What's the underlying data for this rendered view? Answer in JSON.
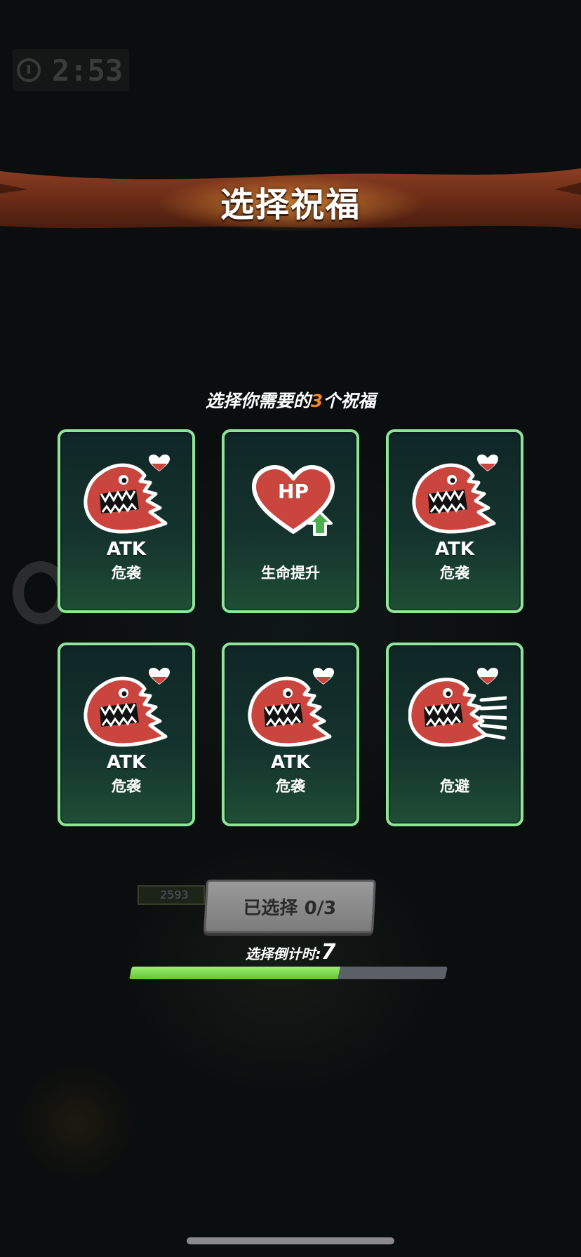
{
  "hud": {
    "time": "2:53",
    "icon": "clock-icon"
  },
  "header": {
    "title": "选择祝福"
  },
  "prompt": {
    "prefix": "选择你需要的",
    "count": "3",
    "suffix": "个祝福"
  },
  "cards": [
    {
      "icon": "dino-atk-icon",
      "badge": "heart-badge-icon",
      "atk_label": "ATK",
      "name": "危袭"
    },
    {
      "icon": "hp-heart-up-icon",
      "badge": "",
      "atk_label": "",
      "name": "生命提升"
    },
    {
      "icon": "dino-atk-icon",
      "badge": "heart-badge-icon",
      "atk_label": "ATK",
      "name": "危袭"
    },
    {
      "icon": "dino-atk-icon",
      "badge": "heart-badge-icon",
      "atk_label": "ATK",
      "name": "危袭"
    },
    {
      "icon": "dino-atk-icon",
      "badge": "heart-badge-icon",
      "atk_label": "ATK",
      "name": "危袭"
    },
    {
      "icon": "dino-dash-icon",
      "badge": "heart-badge-icon",
      "atk_label": "",
      "name": "危避"
    }
  ],
  "footer": {
    "selected_label": "已选择 0/3",
    "countdown_label": "选择倒计时:",
    "countdown_value": "7",
    "progress_fraction": 0.66,
    "hp_mini": "2593"
  },
  "colors": {
    "card_border": "#8fe49a",
    "accent_orange": "#f08a1c",
    "progress_green": "#78d14a",
    "monster_red": "#c9453d"
  }
}
